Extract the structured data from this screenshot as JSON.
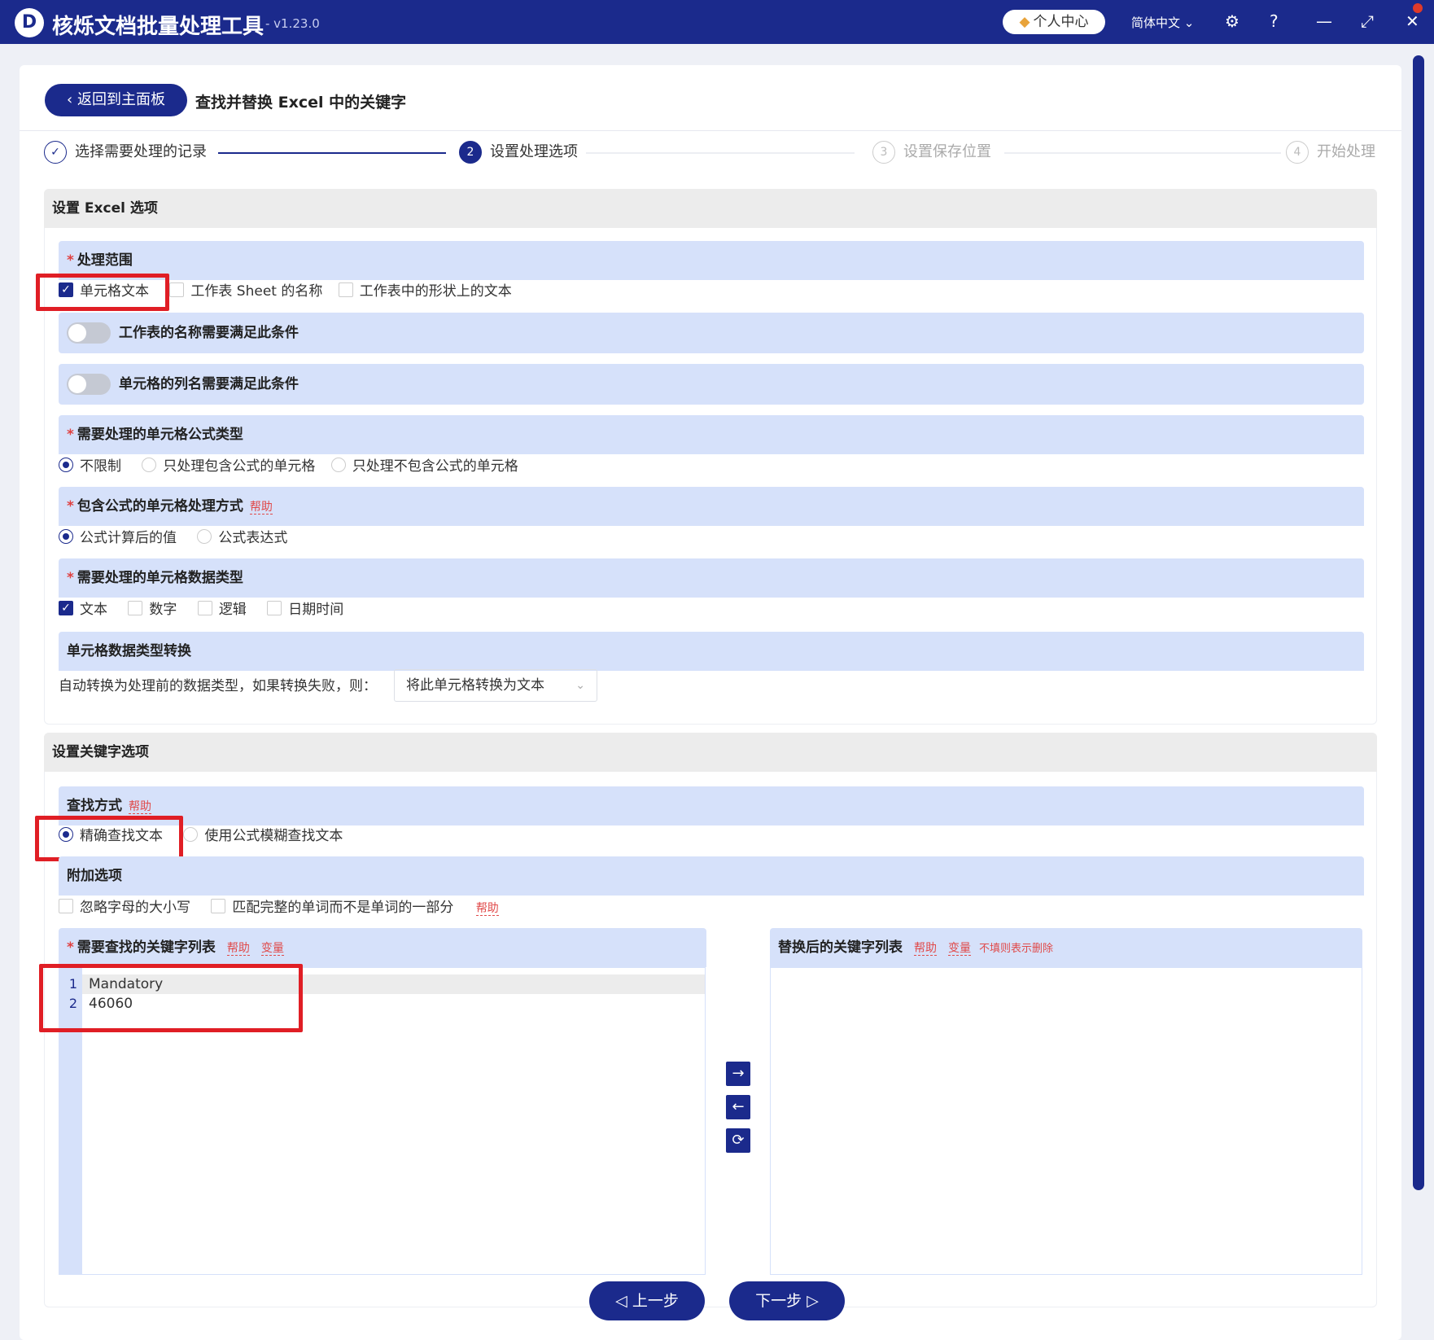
{
  "app": {
    "logo": "D",
    "title": "核烁文档批量处理工具",
    "version": "- v1.23.0",
    "user_center": "个人中心",
    "language": "简体中文"
  },
  "icons": {
    "user": "diamond-icon",
    "lang_chevron": "chevron-down-icon",
    "settings": "gear-icon",
    "help": "question-icon",
    "min": "minimize-icon",
    "max": "maximize-icon",
    "close": "close-icon"
  },
  "header": {
    "back_label": "返回到主面板",
    "page_title": "查找并替换 Excel 中的关键字"
  },
  "steps": [
    {
      "num": "✓",
      "label": "选择需要处理的记录"
    },
    {
      "num": "2",
      "label": "设置处理选项"
    },
    {
      "num": "3",
      "label": "设置保存位置"
    },
    {
      "num": "4",
      "label": "开始处理"
    }
  ],
  "excel": {
    "section_title": "设置 Excel 选项",
    "scope": {
      "label": "处理范围",
      "options": [
        "单元格文本",
        "工作表 Sheet 的名称",
        "工作表中的形状上的文本"
      ]
    },
    "toggle_sheet": "工作表的名称需要满足此条件",
    "toggle_column": "单元格的列名需要满足此条件",
    "formula_type": {
      "label": "需要处理的单元格公式类型",
      "options": [
        "不限制",
        "只处理包含公式的单元格",
        "只处理不包含公式的单元格"
      ]
    },
    "formula_mode": {
      "label": "包含公式的单元格处理方式",
      "help": "帮助",
      "options": [
        "公式计算后的值",
        "公式表达式"
      ]
    },
    "data_type": {
      "label": "需要处理的单元格数据类型",
      "options": [
        "文本",
        "数字",
        "逻辑",
        "日期时间"
      ]
    },
    "convert": {
      "label": "单元格数据类型转换",
      "desc": "自动转换为处理前的数据类型，如果转换失败，则：",
      "select_value": "将此单元格转换为文本"
    }
  },
  "keyword": {
    "section_title": "设置关键字选项",
    "find_mode": {
      "label": "查找方式",
      "help": "帮助",
      "options": [
        "精确查找文本",
        "使用公式模糊查找文本"
      ]
    },
    "extra": {
      "label": "附加选项",
      "options": [
        "忽略字母的大小写",
        "匹配完整的单词而不是单词的一部分"
      ],
      "help": "帮助"
    },
    "find_list": {
      "label": "需要查找的关键字列表",
      "help": "帮助",
      "var": "变量",
      "lines": [
        {
          "n": "1",
          "text": "Mandatory"
        },
        {
          "n": "2",
          "text": "46060"
        }
      ]
    },
    "replace_list": {
      "label": "替换后的关键字列表",
      "help": "帮助",
      "var": "变量",
      "note": "不填则表示删除"
    }
  },
  "nav": {
    "prev": "上一步",
    "next": "下一步"
  },
  "colors": {
    "primary": "#1b2a8c",
    "group_bg": "#d6e1fa",
    "highlight": "#e01e25"
  }
}
